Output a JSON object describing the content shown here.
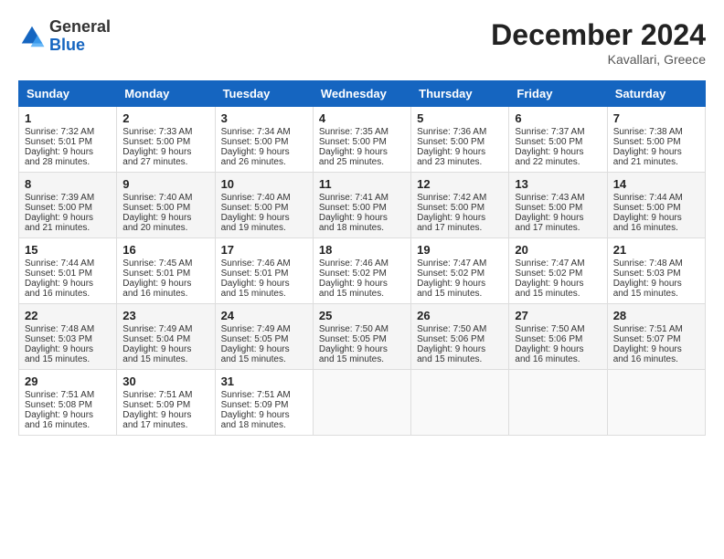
{
  "header": {
    "logo_line1": "General",
    "logo_line2": "Blue",
    "month": "December 2024",
    "location": "Kavallari, Greece"
  },
  "days_of_week": [
    "Sunday",
    "Monday",
    "Tuesday",
    "Wednesday",
    "Thursday",
    "Friday",
    "Saturday"
  ],
  "weeks": [
    [
      {
        "day": 1,
        "sunrise": "7:32 AM",
        "sunset": "5:01 PM",
        "daylight": "9 hours and 28 minutes."
      },
      {
        "day": 2,
        "sunrise": "7:33 AM",
        "sunset": "5:00 PM",
        "daylight": "9 hours and 27 minutes."
      },
      {
        "day": 3,
        "sunrise": "7:34 AM",
        "sunset": "5:00 PM",
        "daylight": "9 hours and 26 minutes."
      },
      {
        "day": 4,
        "sunrise": "7:35 AM",
        "sunset": "5:00 PM",
        "daylight": "9 hours and 25 minutes."
      },
      {
        "day": 5,
        "sunrise": "7:36 AM",
        "sunset": "5:00 PM",
        "daylight": "9 hours and 23 minutes."
      },
      {
        "day": 6,
        "sunrise": "7:37 AM",
        "sunset": "5:00 PM",
        "daylight": "9 hours and 22 minutes."
      },
      {
        "day": 7,
        "sunrise": "7:38 AM",
        "sunset": "5:00 PM",
        "daylight": "9 hours and 21 minutes."
      }
    ],
    [
      {
        "day": 8,
        "sunrise": "7:39 AM",
        "sunset": "5:00 PM",
        "daylight": "9 hours and 21 minutes."
      },
      {
        "day": 9,
        "sunrise": "7:40 AM",
        "sunset": "5:00 PM",
        "daylight": "9 hours and 20 minutes."
      },
      {
        "day": 10,
        "sunrise": "7:40 AM",
        "sunset": "5:00 PM",
        "daylight": "9 hours and 19 minutes."
      },
      {
        "day": 11,
        "sunrise": "7:41 AM",
        "sunset": "5:00 PM",
        "daylight": "9 hours and 18 minutes."
      },
      {
        "day": 12,
        "sunrise": "7:42 AM",
        "sunset": "5:00 PM",
        "daylight": "9 hours and 17 minutes."
      },
      {
        "day": 13,
        "sunrise": "7:43 AM",
        "sunset": "5:00 PM",
        "daylight": "9 hours and 17 minutes."
      },
      {
        "day": 14,
        "sunrise": "7:44 AM",
        "sunset": "5:00 PM",
        "daylight": "9 hours and 16 minutes."
      }
    ],
    [
      {
        "day": 15,
        "sunrise": "7:44 AM",
        "sunset": "5:01 PM",
        "daylight": "9 hours and 16 minutes."
      },
      {
        "day": 16,
        "sunrise": "7:45 AM",
        "sunset": "5:01 PM",
        "daylight": "9 hours and 16 minutes."
      },
      {
        "day": 17,
        "sunrise": "7:46 AM",
        "sunset": "5:01 PM",
        "daylight": "9 hours and 15 minutes."
      },
      {
        "day": 18,
        "sunrise": "7:46 AM",
        "sunset": "5:02 PM",
        "daylight": "9 hours and 15 minutes."
      },
      {
        "day": 19,
        "sunrise": "7:47 AM",
        "sunset": "5:02 PM",
        "daylight": "9 hours and 15 minutes."
      },
      {
        "day": 20,
        "sunrise": "7:47 AM",
        "sunset": "5:02 PM",
        "daylight": "9 hours and 15 minutes."
      },
      {
        "day": 21,
        "sunrise": "7:48 AM",
        "sunset": "5:03 PM",
        "daylight": "9 hours and 15 minutes."
      }
    ],
    [
      {
        "day": 22,
        "sunrise": "7:48 AM",
        "sunset": "5:03 PM",
        "daylight": "9 hours and 15 minutes."
      },
      {
        "day": 23,
        "sunrise": "7:49 AM",
        "sunset": "5:04 PM",
        "daylight": "9 hours and 15 minutes."
      },
      {
        "day": 24,
        "sunrise": "7:49 AM",
        "sunset": "5:05 PM",
        "daylight": "9 hours and 15 minutes."
      },
      {
        "day": 25,
        "sunrise": "7:50 AM",
        "sunset": "5:05 PM",
        "daylight": "9 hours and 15 minutes."
      },
      {
        "day": 26,
        "sunrise": "7:50 AM",
        "sunset": "5:06 PM",
        "daylight": "9 hours and 15 minutes."
      },
      {
        "day": 27,
        "sunrise": "7:50 AM",
        "sunset": "5:06 PM",
        "daylight": "9 hours and 16 minutes."
      },
      {
        "day": 28,
        "sunrise": "7:51 AM",
        "sunset": "5:07 PM",
        "daylight": "9 hours and 16 minutes."
      }
    ],
    [
      {
        "day": 29,
        "sunrise": "7:51 AM",
        "sunset": "5:08 PM",
        "daylight": "9 hours and 16 minutes."
      },
      {
        "day": 30,
        "sunrise": "7:51 AM",
        "sunset": "5:09 PM",
        "daylight": "9 hours and 17 minutes."
      },
      {
        "day": 31,
        "sunrise": "7:51 AM",
        "sunset": "5:09 PM",
        "daylight": "9 hours and 18 minutes."
      },
      null,
      null,
      null,
      null
    ]
  ]
}
